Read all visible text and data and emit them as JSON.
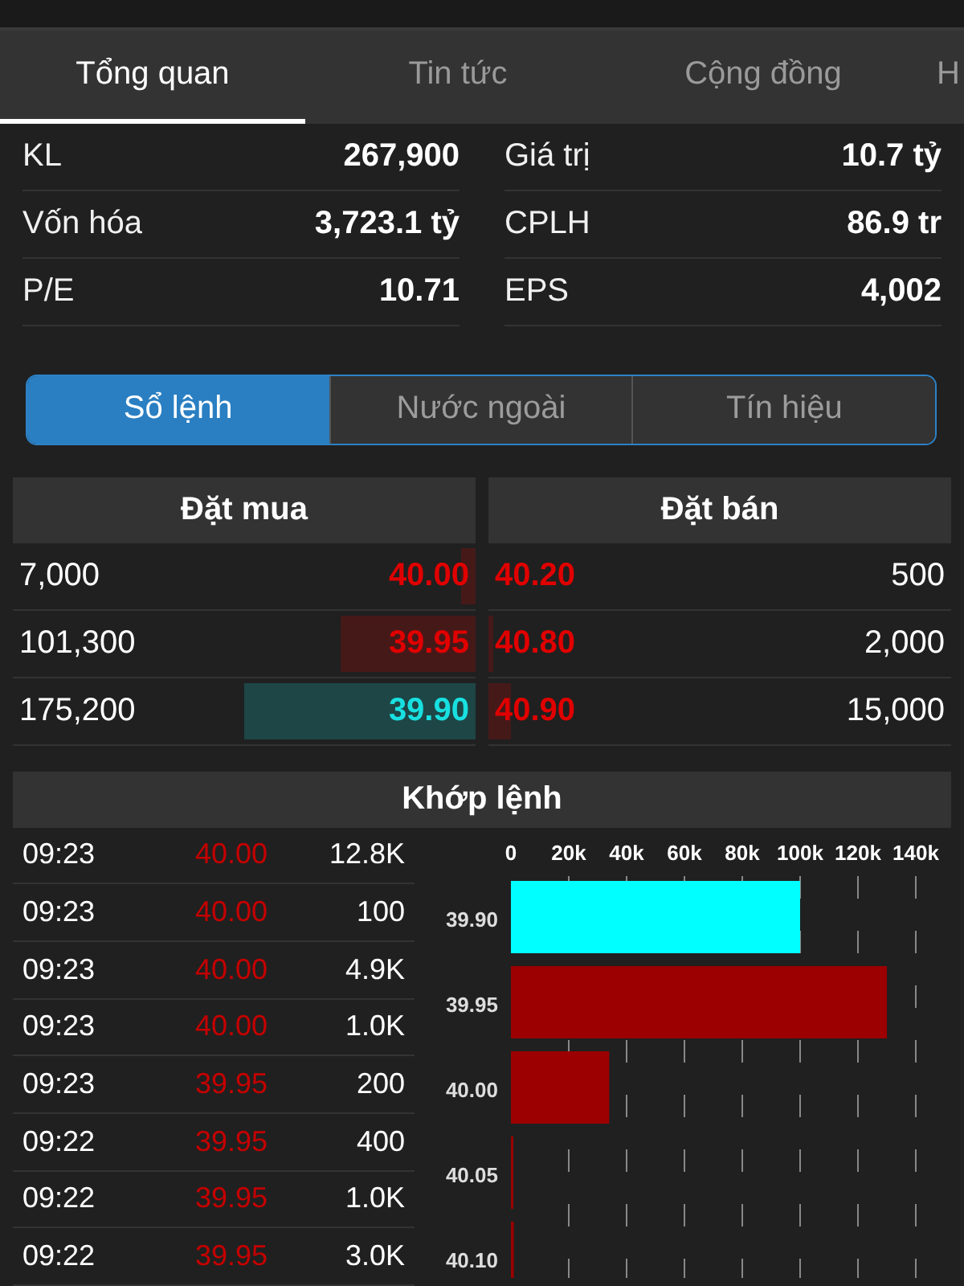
{
  "tabs": [
    {
      "label": "Tổng quan",
      "selected": true
    },
    {
      "label": "Tin tức",
      "selected": false
    },
    {
      "label": "Cộng đồng",
      "selected": false
    },
    {
      "label": "H",
      "selected": false
    }
  ],
  "stats": [
    {
      "label": "KL",
      "value": "267,900"
    },
    {
      "label": "Giá trị",
      "value": "10.7 tỷ"
    },
    {
      "label": "Vốn hóa",
      "value": "3,723.1 tỷ"
    },
    {
      "label": "CPLH",
      "value": "86.9 tr"
    },
    {
      "label": "P/E",
      "value": "10.71"
    },
    {
      "label": "EPS",
      "value": "4,002"
    }
  ],
  "segments": [
    {
      "label": "Sổ lệnh",
      "selected": true
    },
    {
      "label": "Nước ngoài",
      "selected": false
    },
    {
      "label": "Tín hiệu",
      "selected": false
    }
  ],
  "order_book": {
    "bid_header": "Đặt mua",
    "ask_header": "Đặt bán",
    "bids": [
      {
        "volume": "7,000",
        "price": "40.00",
        "color": "#e00000",
        "level": 0.03
      },
      {
        "volume": "101,300",
        "price": "39.95",
        "color": "#e00000",
        "level": 0.29
      },
      {
        "volume": "175,200",
        "price": "39.90",
        "color": "#19e0e0",
        "level": 0.5
      }
    ],
    "asks": [
      {
        "price": "40.20",
        "volume": "500",
        "color": "#e00000",
        "level": 0
      },
      {
        "price": "40.80",
        "volume": "2,000",
        "color": "#e00000",
        "level": 0.01
      },
      {
        "price": "40.90",
        "volume": "15,000",
        "color": "#e00000",
        "level": 0.05
      }
    ]
  },
  "matches": {
    "title": "Khớp lệnh",
    "rows": [
      {
        "time": "09:23",
        "price": "40.00",
        "volume": "12.8K"
      },
      {
        "time": "09:23",
        "price": "40.00",
        "volume": "100"
      },
      {
        "time": "09:23",
        "price": "40.00",
        "volume": "4.9K"
      },
      {
        "time": "09:23",
        "price": "40.00",
        "volume": "1.0K"
      },
      {
        "time": "09:23",
        "price": "39.95",
        "volume": "200"
      },
      {
        "time": "09:22",
        "price": "39.95",
        "volume": "400"
      },
      {
        "time": "09:22",
        "price": "39.95",
        "volume": "1.0K"
      },
      {
        "time": "09:22",
        "price": "39.95",
        "volume": "3.0K"
      }
    ],
    "chart_data": {
      "type": "bar",
      "orientation": "horizontal",
      "grid": true,
      "categories": [
        "39.90",
        "39.95",
        "40.00",
        "40.05",
        "40.10"
      ],
      "series": [
        {
          "color": "#00ffff",
          "values": [
            100000,
            null,
            null,
            null,
            null
          ]
        },
        {
          "color": "#9c0000",
          "values": [
            null,
            130000,
            34000,
            300,
            1000
          ]
        }
      ],
      "xlim": [
        0,
        140000
      ],
      "xticks": [
        {
          "value": 0,
          "label": "0"
        },
        {
          "value": 20000,
          "label": "20k"
        },
        {
          "value": 40000,
          "label": "40k"
        },
        {
          "value": 60000,
          "label": "60k"
        },
        {
          "value": 80000,
          "label": "80k"
        },
        {
          "value": 100000,
          "label": "100k"
        },
        {
          "value": 120000,
          "label": "120k"
        },
        {
          "value": 140000,
          "label": "140k"
        }
      ]
    }
  }
}
